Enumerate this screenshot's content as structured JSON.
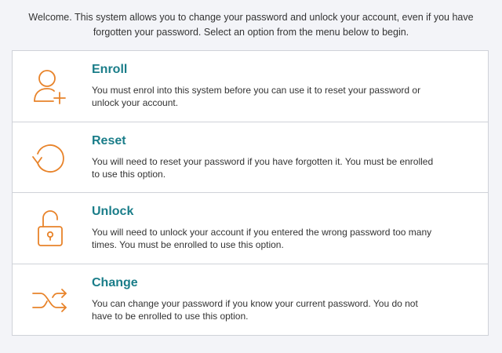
{
  "intro": {
    "text": "Welcome. This system allows you to change your password and unlock your account, even if you have forgotten your password. Select an option from the menu below to begin."
  },
  "colors": {
    "accent": "#1a7d89",
    "icon": "#e8832a",
    "border": "#cfd2d8",
    "background": "#f3f4f8"
  },
  "options": [
    {
      "icon": "user-plus-icon",
      "title": "Enroll",
      "description": "You must enrol into this system before you can use it to reset your password or unlock your account."
    },
    {
      "icon": "reset-arrow-icon",
      "title": "Reset",
      "description": "You will need to reset your password if you have forgotten it. You must be enrolled to use this option."
    },
    {
      "icon": "unlocked-padlock-icon",
      "title": "Unlock",
      "description": "You will need to unlock your account if you entered the wrong password too many times. You must be enrolled to use this option."
    },
    {
      "icon": "shuffle-arrows-icon",
      "title": "Change",
      "description": "You can change your password if you know your current password. You do not have to be enrolled to use this option."
    }
  ]
}
